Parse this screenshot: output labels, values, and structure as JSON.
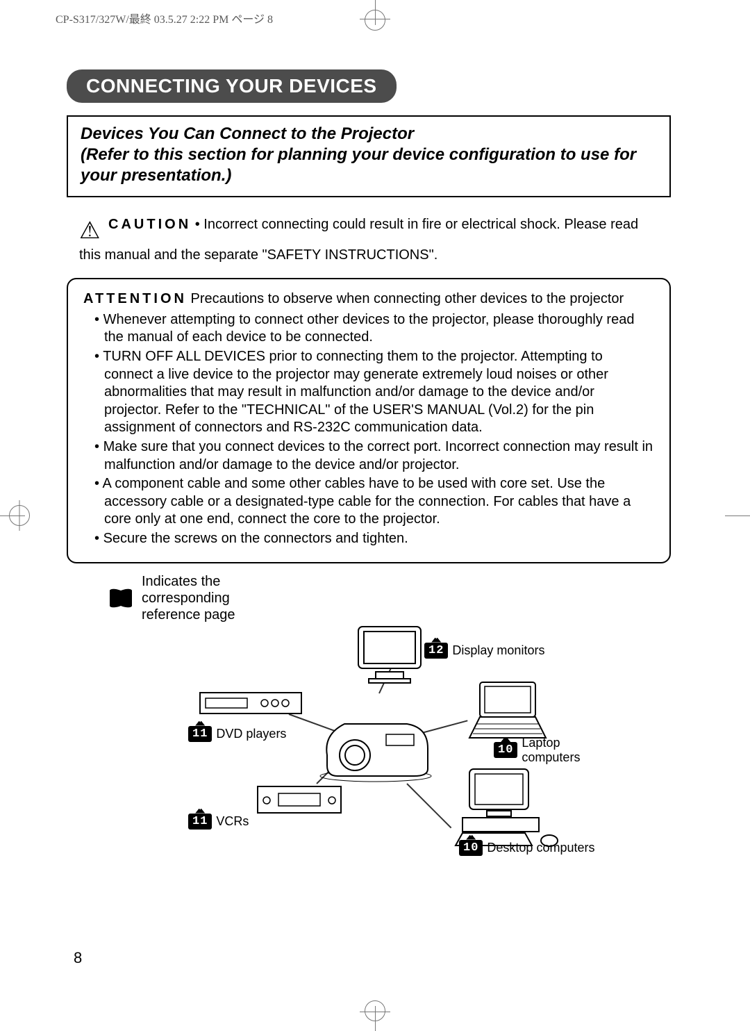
{
  "crop_header": "CP-S317/327W/最終  03.5.27 2:22 PM  ページ 8",
  "section_title": "CONNECTING YOUR DEVICES",
  "intro_line1": "Devices You Can Connect to the Projector",
  "intro_line2": "(Refer to this section for planning your device configuration to use for your presentation.)",
  "caution": {
    "label": "CAUTION",
    "text": " • Incorrect connecting could result in fire or electrical shock. Please read this manual and the separate \"SAFETY INSTRUCTIONS\"."
  },
  "attention": {
    "label": "ATTENTION",
    "lead": "  Precautions to observe when connecting other devices to the projector",
    "bullets": [
      "Whenever attempting to connect other devices to the projector, please thoroughly read the manual of each device to be connected.",
      "TURN OFF ALL DEVICES prior to connecting them to the projector. Attempting to connect a live device to the projector may generate extremely loud noises or other abnormalities that may result in malfunction and/or damage to the device and/or projector. Refer to the \"TECHNICAL\" of the USER'S MANUAL (Vol.2) for the pin assignment of connectors and RS-232C communication data.",
      "Make sure that you connect devices to the correct port. Incorrect connection may result in malfunction and/or damage to the device and/or projector.",
      "A component cable and some other cables have to be used with core set. Use the accessory cable or a designated-type cable for the connection. For cables that have a core only at one end, connect the core to the projector.",
      "Secure the screws on the connectors and tighten."
    ]
  },
  "legend_text": "Indicates the corresponding reference page",
  "devices": {
    "display_monitors": {
      "page": "12",
      "label": "Display monitors"
    },
    "dvd_players": {
      "page": "11",
      "label": "DVD players"
    },
    "laptop_computers": {
      "page": "10",
      "label": "Laptop computers"
    },
    "vcrs": {
      "page": "11",
      "label": "VCRs"
    },
    "desktop_computers": {
      "page": "10",
      "label": "Desktop computers"
    }
  },
  "page_number": "8"
}
